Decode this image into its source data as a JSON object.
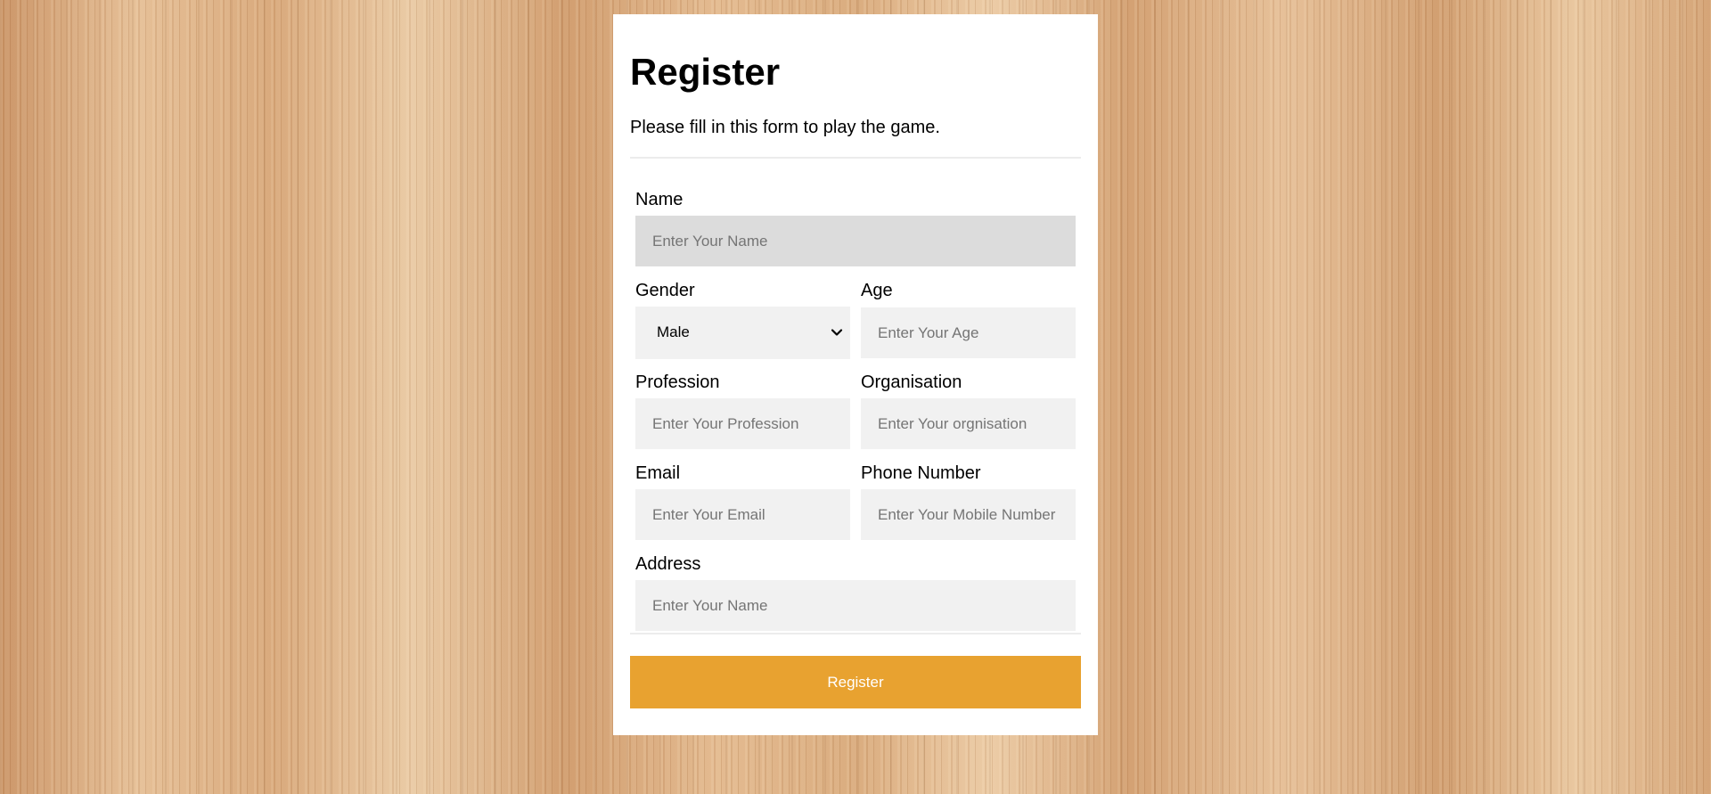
{
  "form": {
    "title": "Register",
    "subtitle": "Please fill in this form to play the game.",
    "fields": {
      "name": {
        "label": "Name",
        "placeholder": "Enter Your Name",
        "value": ""
      },
      "gender": {
        "label": "Gender",
        "selected": "Male"
      },
      "age": {
        "label": "Age",
        "placeholder": "Enter Your Age",
        "value": ""
      },
      "profession": {
        "label": "Profession",
        "placeholder": "Enter Your Profession",
        "value": ""
      },
      "organisation": {
        "label": "Organisation",
        "placeholder": "Enter Your orgnisation",
        "value": ""
      },
      "email": {
        "label": "Email",
        "placeholder": "Enter Your Email",
        "value": ""
      },
      "phone": {
        "label": "Phone Number",
        "placeholder": "Enter Your Mobile Number",
        "value": ""
      },
      "address": {
        "label": "Address",
        "placeholder": "Enter Your Name",
        "value": ""
      }
    },
    "submit_label": "Register"
  },
  "icons": {
    "select_arrow": "chevron-down-icon"
  },
  "colors": {
    "accent": "#e8a230",
    "card_background": "#ffffff",
    "input_background": "#f1f1f1",
    "input_focused_background": "#dcdcdc"
  }
}
